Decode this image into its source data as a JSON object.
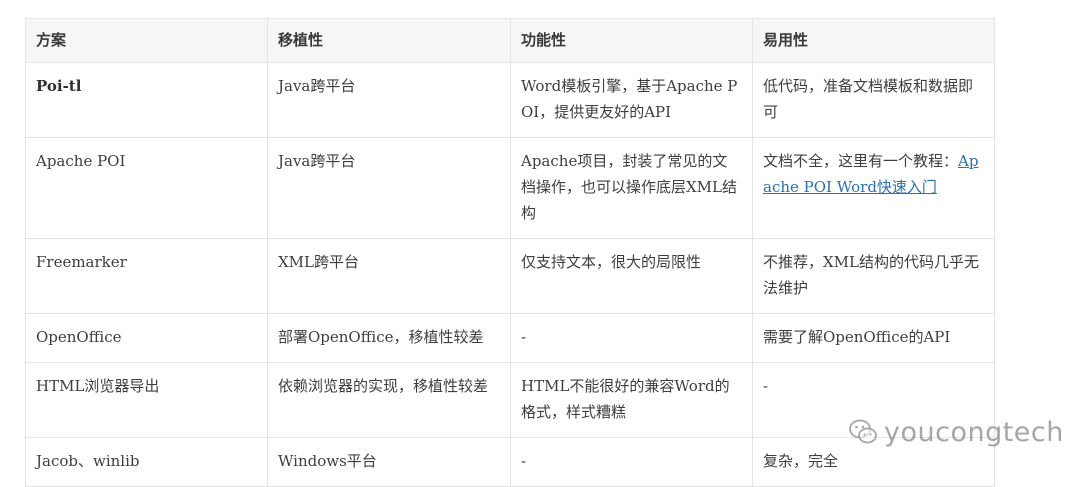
{
  "table": {
    "headers": [
      "方案",
      "移植性",
      "功能性",
      "易用性"
    ],
    "rows": [
      {
        "solution": "Poi-tl",
        "portability": "Java跨平台",
        "functionality": "Word模板引擎，基于Apache POI，提供更友好的API",
        "usability": "低代码，准备文档模板和数据即可"
      },
      {
        "solution": "Apache POI",
        "portability": "Java跨平台",
        "functionality": "Apache项目，封装了常见的文档操作，也可以操作底层XML结构",
        "usability_prefix": "文档不全，这里有一个教程：",
        "usability_link": "Apache POI Word快速入门"
      },
      {
        "solution": "Freemarker",
        "portability": "XML跨平台",
        "functionality": "仅支持文本，很大的局限性",
        "usability": "不推荐，XML结构的代码几乎无法维护"
      },
      {
        "solution": "OpenOffice",
        "portability": "部署OpenOffice，移植性较差",
        "functionality": "-",
        "usability": "需要了解OpenOffice的API"
      },
      {
        "solution": "HTML浏览器导出",
        "portability": "依赖浏览器的实现，移植性较差",
        "functionality": "HTML不能很好的兼容Word的格式，样式糟糕",
        "usability": "-"
      },
      {
        "solution": "Jacob、winlib",
        "portability": "Windows平台",
        "functionality": "-",
        "usability": "复杂，完全"
      }
    ]
  },
  "watermark": {
    "text": "youcongtech",
    "icon": "wechat-icon"
  }
}
